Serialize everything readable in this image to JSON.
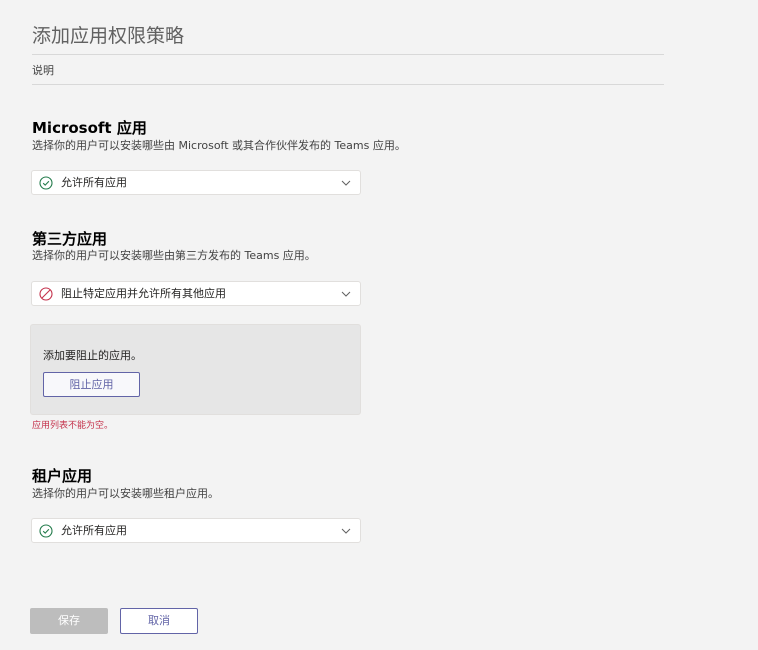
{
  "form": {
    "title": "添加应用权限策略",
    "description_label": "说明"
  },
  "sections": [
    {
      "heading": "Microsoft 应用",
      "subtitle": "选择你的用户可以安装哪些由 Microsoft 或其合作伙伴发布的 Teams 应用。",
      "selected": "允许所有应用",
      "icon": "check-circle-icon"
    },
    {
      "heading": "第三方应用",
      "subtitle": "选择你的用户可以安装哪些由第三方发布的 Teams 应用。",
      "selected": "阻止特定应用并允许所有其他应用",
      "icon": "block-icon"
    },
    {
      "heading": "租户应用",
      "subtitle": "选择你的用户可以安装哪些租户应用。",
      "selected": "允许所有应用",
      "icon": "check-circle-icon"
    }
  ],
  "block_panel": {
    "prompt": "添加要阻止的应用。",
    "button_label": "阻止应用",
    "error": "应用列表不能为空。"
  },
  "footer": {
    "save_label": "保存",
    "cancel_label": "取消"
  },
  "colors": {
    "accent": "#6264a7",
    "success": "#237b4b",
    "error": "#c4314b",
    "disabled": "#bdbdbd"
  }
}
